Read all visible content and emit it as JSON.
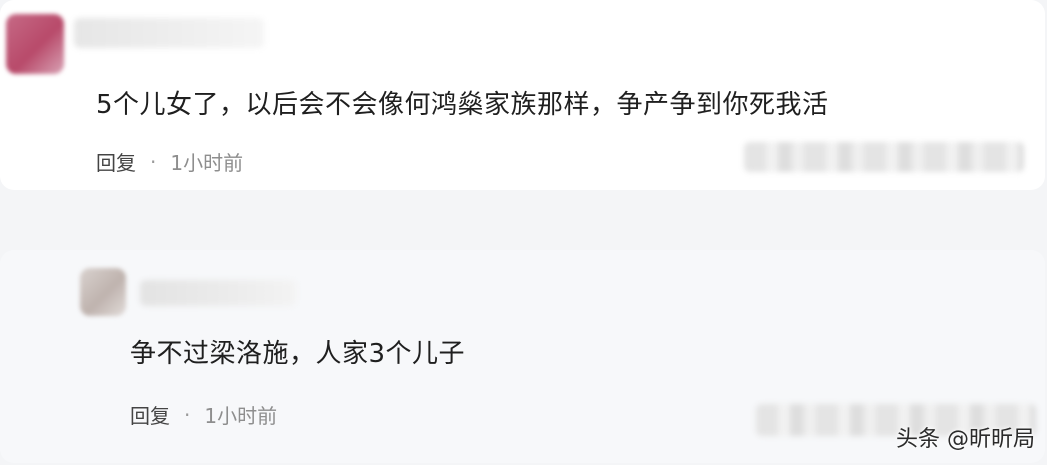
{
  "comments": [
    {
      "text": "5个儿女了，以后会不会像何鸿燊家族那样，争产争到你死我活",
      "reply_label": "回复",
      "separator": "·",
      "time": "1小时前"
    },
    {
      "text": "争不过梁洛施，人家3个儿子",
      "reply_label": "回复",
      "separator": "·",
      "time": "1小时前"
    }
  ],
  "watermark": "头条 @昕昕局",
  "colors": {
    "avatar_1": "#c66a86",
    "avatar_2": "#cfc6c2",
    "text": "#1f1f1f",
    "meta": "#8e8e8e"
  }
}
